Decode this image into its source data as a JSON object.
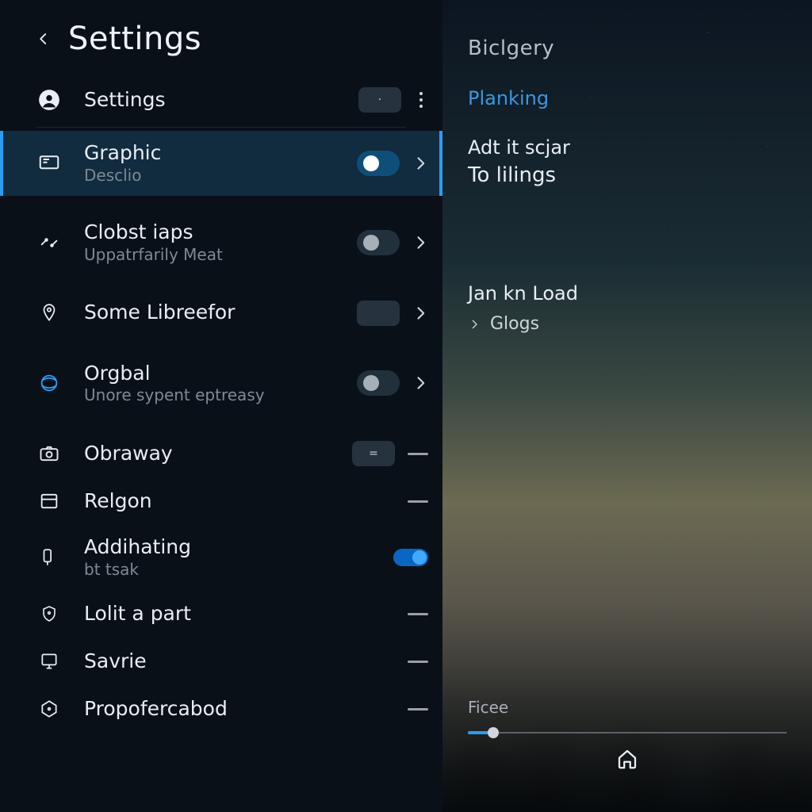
{
  "colors": {
    "accent": "#2a9df4",
    "bg": "#0a1018",
    "selectedRow": "#112b3f"
  },
  "header": {
    "title": "Settings"
  },
  "topRow": {
    "label": "Settings",
    "value": "·"
  },
  "items": [
    {
      "label": "Graphic",
      "sub": "Desclio",
      "toggle": "on",
      "chevron": true,
      "selected": true,
      "icon": "display"
    },
    {
      "label": "Clobst iaps",
      "sub": "Uppatrfarily Meat",
      "toggle": "off",
      "chevron": true,
      "selected": false,
      "icon": "arrows"
    },
    {
      "label": "Some Libreefor",
      "sub": "",
      "toggle": "empty",
      "chevron": true,
      "selected": false,
      "icon": "pin"
    },
    {
      "label": "Orgbal",
      "sub": "Unore sypent eptreasy",
      "toggle": "off",
      "chevron": true,
      "selected": false,
      "icon": "orbit"
    },
    {
      "label": "Obraway",
      "sub": "",
      "value": "=",
      "dash": true,
      "selected": false,
      "icon": "camera"
    },
    {
      "label": "Relgon",
      "sub": "",
      "dash": true,
      "selected": false,
      "icon": "panel"
    },
    {
      "label": "Addihating",
      "sub": "bt tsak",
      "switch": "on",
      "selected": false,
      "icon": "pointer"
    },
    {
      "label": "Lolit a part",
      "sub": "",
      "dash": true,
      "selected": false,
      "icon": "shield"
    },
    {
      "label": "Savrie",
      "sub": "",
      "dash": true,
      "selected": false,
      "icon": "monitor"
    },
    {
      "label": "Propofercabod",
      "sub": "",
      "dash": true,
      "selected": false,
      "icon": "hex"
    }
  ],
  "right": {
    "title": "Biclgery",
    "link": "Planking",
    "block1_line1": "Adt it scjar",
    "block1_line2": "To lilings",
    "block2_line1": "Jan kn Load",
    "block2_small": "Glogs",
    "slider_label": "Ficee",
    "slider_value_pct": 8,
    "slider_min": 0,
    "slider_max": 100
  }
}
